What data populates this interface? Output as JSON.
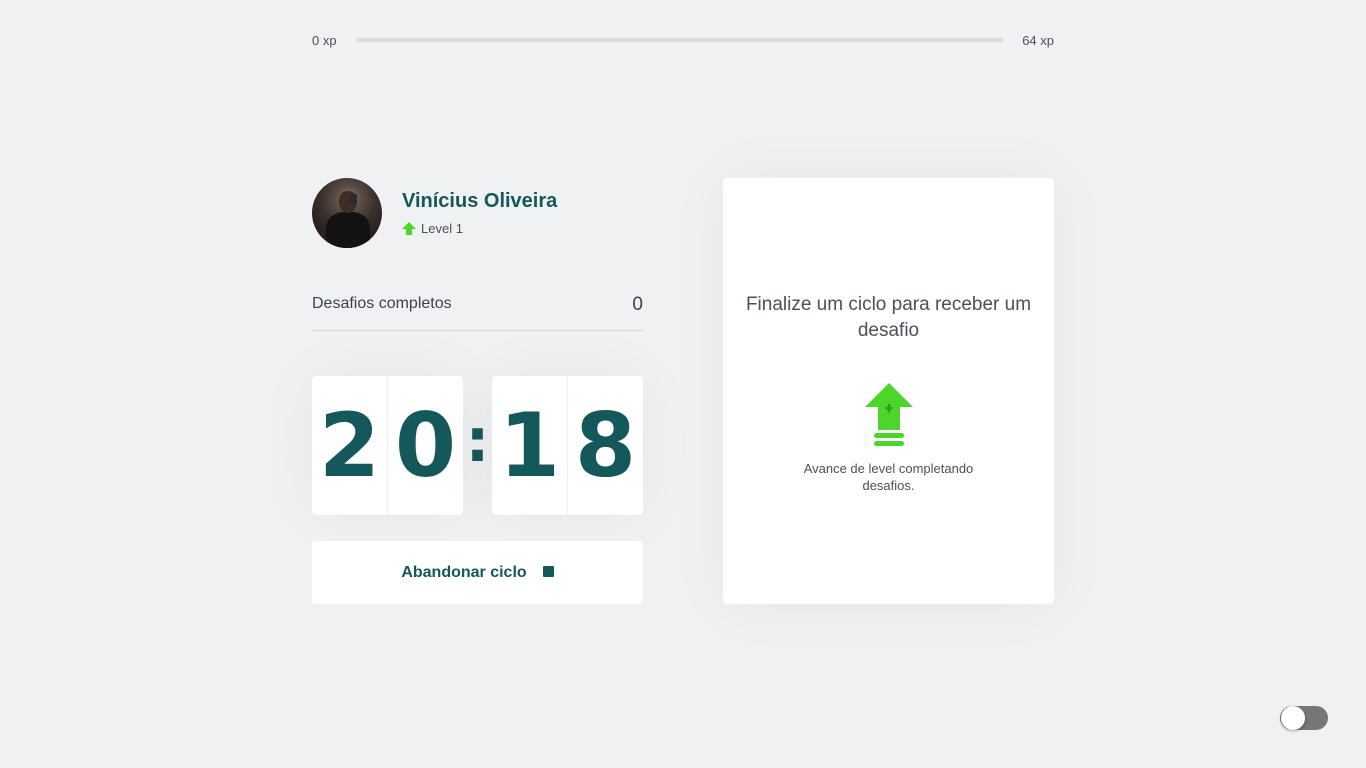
{
  "experience": {
    "start_label": "0 xp",
    "end_label": "64 xp",
    "progress_fraction": 0
  },
  "profile": {
    "name": "Vinícius Oliveira",
    "level_label": "Level 1"
  },
  "completed_challenges": {
    "label": "Desafios completos",
    "count": "0"
  },
  "countdown": {
    "minute_tens": "2",
    "minute_ones": "0",
    "separator": ":",
    "second_tens": "1",
    "second_ones": "8"
  },
  "abandon_button": {
    "label": "Abandonar ciclo"
  },
  "challenge_box": {
    "title": "Finalize um ciclo para receber um desafio",
    "hint": "Avance de level completando desafios."
  },
  "colors": {
    "accent": "#15585c",
    "level_up_green": "#4cd62b",
    "background": "#f0f1f3"
  },
  "icons": {
    "level": "level-up-arrow-icon",
    "stop": "stop-square-icon",
    "challenge": "level-up-arrow-icon"
  },
  "theme_toggle": {
    "state": "off"
  }
}
